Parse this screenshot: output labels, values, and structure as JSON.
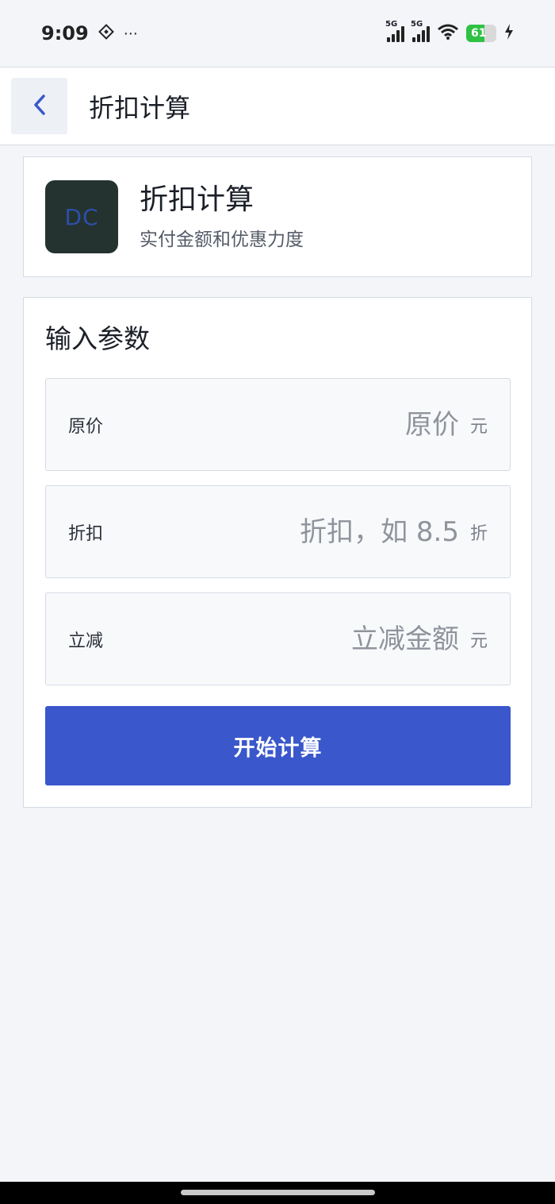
{
  "status_bar": {
    "time": "9:09",
    "extra": "⋯",
    "sim1_label": "5G",
    "sim2_label": "5G",
    "battery_level": "61",
    "battery_fraction": 0.61
  },
  "topbar": {
    "title": "折扣计算",
    "back_icon": "chevron-left-icon"
  },
  "header": {
    "logo_text": "DC",
    "title": "折扣计算",
    "subtitle": "实付金额和优惠力度"
  },
  "form": {
    "section_title": "输入参数",
    "fields": [
      {
        "label": "原价",
        "placeholder": "原价",
        "value": "",
        "unit": "元"
      },
      {
        "label": "折扣",
        "placeholder": "折扣，如 8.5",
        "value": "",
        "unit": "折"
      },
      {
        "label": "立减",
        "placeholder": "立减金额",
        "value": "",
        "unit": "元"
      }
    ],
    "submit_label": "开始计算"
  },
  "colors": {
    "accent": "#3a57cb",
    "background": "#f3f5f9",
    "card": "#ffffff",
    "logo_bg": "#243330"
  }
}
